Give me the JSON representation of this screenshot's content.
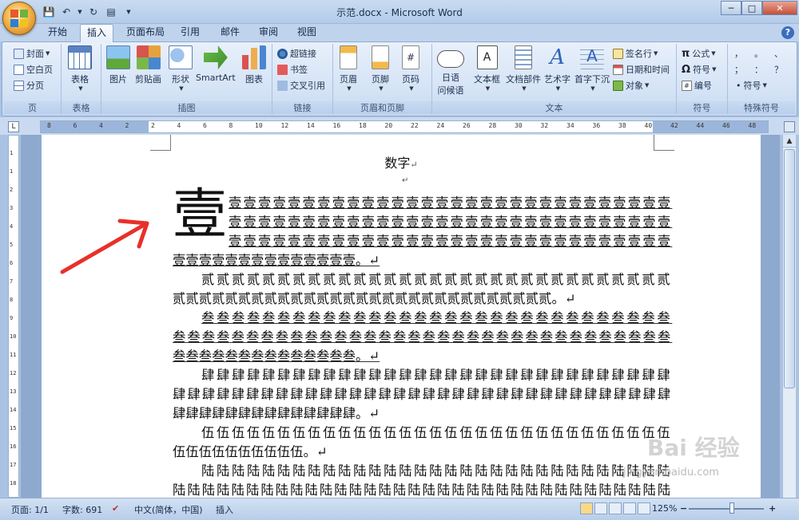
{
  "window": {
    "title": "示范.docx - Microsoft Word",
    "min": "─",
    "max": "□",
    "close": "✕",
    "help": "?"
  },
  "qat": {
    "items": [
      "save-icon",
      "undo-icon",
      "dropdown",
      "redo-icon",
      "print-icon",
      "customize"
    ]
  },
  "tabs": [
    {
      "label": "开始",
      "active": false
    },
    {
      "label": "插入",
      "active": true
    },
    {
      "label": "页面布局",
      "active": false
    },
    {
      "label": "引用",
      "active": false
    },
    {
      "label": "邮件",
      "active": false
    },
    {
      "label": "审阅",
      "active": false
    },
    {
      "label": "视图",
      "active": false
    }
  ],
  "ribbon": {
    "pages": {
      "label": "页",
      "cover": "封面",
      "blank": "空白页",
      "pagebreak": "分页"
    },
    "tables": {
      "label": "表格",
      "table": "表格"
    },
    "illustrations": {
      "label": "插图",
      "picture": "图片",
      "clipart": "剪贴画",
      "shapes": "形状",
      "smartart": "SmartArt",
      "chart": "图表"
    },
    "links": {
      "label": "链接",
      "hyperlink": "超链接",
      "bookmark": "书签",
      "crossref": "交叉引用"
    },
    "headerfooter": {
      "label": "页眉和页脚",
      "header": "页眉",
      "footer": "页脚",
      "pagenum": "页码"
    },
    "text": {
      "label": "文本",
      "greeting1": "日语",
      "greeting2": "问候语",
      "textbox": "文本框",
      "quickparts": "文档部件",
      "wordart": "艺术字",
      "dropcap": "首字下沉",
      "signature": "签名行",
      "datetime": "日期和时间",
      "object": "对象"
    },
    "symbols": {
      "label": "符号",
      "equation": "公式",
      "symbol": "符号",
      "number": "编号"
    },
    "special": {
      "label": "特殊符号",
      "symbol": "符号",
      "glyphs": [
        "，",
        "。",
        "、",
        "；",
        "：",
        "？"
      ]
    }
  },
  "ruler": {
    "hticks": [
      "8",
      "6",
      "4",
      "2",
      "2",
      "4",
      "6",
      "8",
      "10",
      "12",
      "14",
      "16",
      "18",
      "20",
      "22",
      "24",
      "26",
      "28",
      "30",
      "32",
      "34",
      "36",
      "38",
      "40",
      "42",
      "44",
      "46",
      "48"
    ],
    "vticks": [
      "1",
      "1",
      "2",
      "3",
      "4",
      "5",
      "6",
      "7",
      "8",
      "9",
      "10",
      "11",
      "12",
      "13",
      "14",
      "15",
      "16",
      "17",
      "18"
    ]
  },
  "document": {
    "title": "数字",
    "dropcap": "壹",
    "para_mark": "↵",
    "lines": [
      {
        "text": "壹壹壹壹壹壹壹壹壹壹壹壹壹壹壹壹壹壹壹壹壹壹壹壹壹壹壹壹壹壹",
        "underline": true
      },
      {
        "text": "壹壹壹壹壹壹壹壹壹壹壹壹壹壹壹壹壹壹壹壹壹壹壹壹壹壹壹壹壹壹",
        "underline": true
      },
      {
        "text": "壹壹壹壹壹壹壹壹壹壹壹壹壹壹壹壹壹壹壹壹壹壹壹壹壹壹壹壹壹壹",
        "underline": true
      },
      {
        "text": "壹壹壹壹壹壹壹壹壹壹壹壹壹壹。↵",
        "underline": true
      },
      {
        "text": "贰贰贰贰贰贰贰贰贰贰贰贰贰贰贰贰贰贰贰贰贰贰贰贰贰贰贰贰贰贰贰",
        "underline": false
      },
      {
        "text": "贰贰贰贰贰贰贰贰贰贰贰贰贰贰贰贰贰贰贰贰贰贰贰贰贰贰贰贰贰。↵",
        "underline": false
      },
      {
        "text": "叁叁叁叁叁叁叁叁叁叁叁叁叁叁叁叁叁叁叁叁叁叁叁叁叁叁叁叁叁叁叁",
        "underline": true
      },
      {
        "text": "叁叁叁叁叁叁叁叁叁叁叁叁叁叁叁叁叁叁叁叁叁叁叁叁叁叁叁叁叁叁叁叁叁叁",
        "underline": true
      },
      {
        "text": "叁叁叁叁叁叁叁叁叁叁叁叁叁叁。↵",
        "underline": true
      },
      {
        "text": "肆肆肆肆肆肆肆肆肆肆肆肆肆肆肆肆肆肆肆肆肆肆肆肆肆肆肆肆肆肆肆",
        "underline": false
      },
      {
        "text": "肆肆肆肆肆肆肆肆肆肆肆肆肆肆肆肆肆肆肆肆肆肆肆肆肆肆肆肆肆肆肆肆肆肆",
        "underline": false
      },
      {
        "text": "肆肆肆肆肆肆肆肆肆肆肆肆肆肆。↵",
        "underline": false
      },
      {
        "text": "伍伍伍伍伍伍伍伍伍伍伍伍伍伍伍伍伍伍伍伍伍伍伍伍伍伍伍伍伍伍伍",
        "underline": false
      },
      {
        "text": "伍伍伍伍伍伍伍伍伍伍。↵",
        "underline": false
      },
      {
        "text": "陆陆陆陆陆陆陆陆陆陆陆陆陆陆陆陆陆陆陆陆陆陆陆陆陆陆陆陆陆陆陆",
        "underline": false
      },
      {
        "text": "陆陆陆陆陆陆陆陆陆陆陆陆陆陆陆陆陆陆陆陆陆陆陆陆陆陆陆陆陆陆陆陆陆陆",
        "underline": false
      },
      {
        "text": "陆陆陆陆陆陆陆陆陆陆陆陆陆陆陆",
        "underline": false
      }
    ]
  },
  "status": {
    "page": "页面: 1/1",
    "words": "字数: 691",
    "language": "中文(简体，中国)",
    "mode": "插入",
    "zoom": "125%",
    "zoom_minus": "−",
    "zoom_plus": "+"
  },
  "watermark": {
    "brand": "Bai 经验",
    "url": "jingyan.baidu.com"
  },
  "colors": {
    "accent": "#2b579a",
    "arrow": "#e8302a",
    "ribbon": "#d3e2f5",
    "page": "#ffffff"
  }
}
